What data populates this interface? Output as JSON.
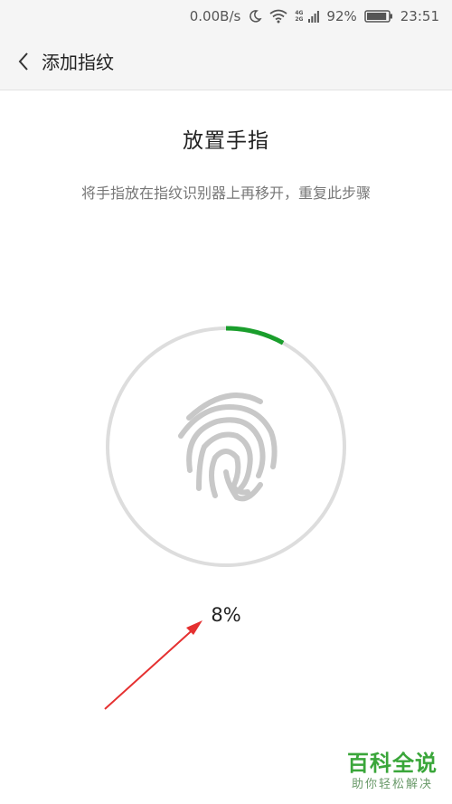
{
  "status_bar": {
    "net_speed": "0.00B/s",
    "net_badge_top": "4G",
    "net_badge_bottom": "2G",
    "battery": "92%",
    "battery_level": 0.92,
    "time": "23:51",
    "icons": [
      "moon-icon",
      "wifi-icon",
      "signal-icon",
      "battery-icon"
    ]
  },
  "header": {
    "back_icon": "chevron-left-icon",
    "title": "添加指纹"
  },
  "main": {
    "title": "放置手指",
    "description": "将手指放在指纹识别器上再移开，重复此步骤",
    "progress_percent_label": "8%",
    "progress_value": 0.08,
    "colors": {
      "progress": "#1a9e2c",
      "track": "#dddddd",
      "fingerprint": "#c8c8c8"
    }
  },
  "annotation": {
    "arrow_color": "#e53030"
  },
  "watermark": {
    "main": "百科全说",
    "sub": "助你轻松解决"
  }
}
